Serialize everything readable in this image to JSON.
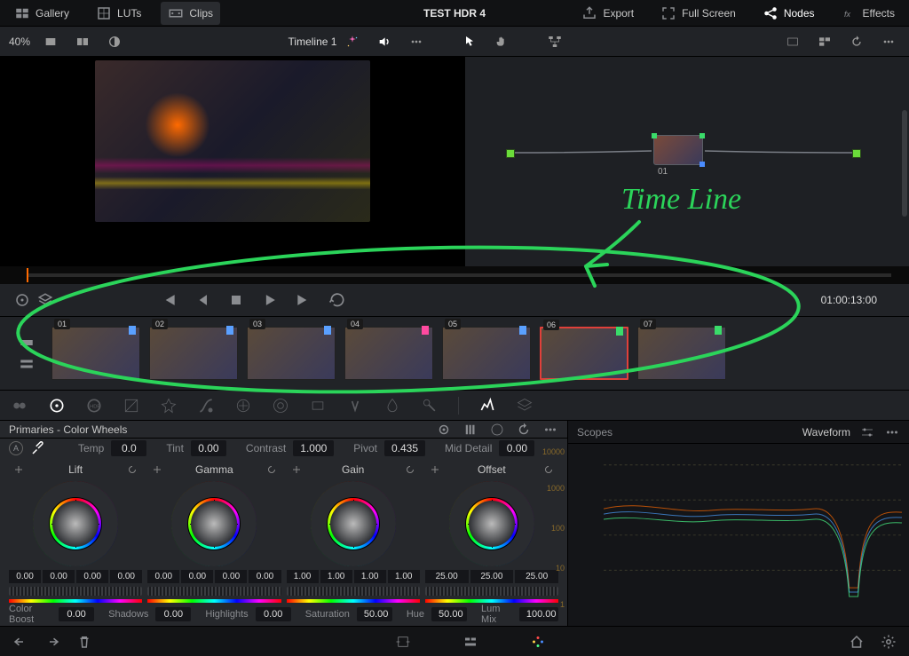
{
  "project_title": "TEST HDR 4",
  "top": {
    "gallery": "Gallery",
    "luts": "LUTs",
    "clips": "Clips",
    "export": "Export",
    "fullscreen": "Full Screen",
    "nodes": "Nodes",
    "effects": "Effects"
  },
  "toolbar": {
    "zoom": "40%",
    "timeline": "Timeline 1"
  },
  "timecode": "01:00:13:00",
  "node": {
    "label": "01"
  },
  "clips": [
    {
      "num": "01",
      "flag": "#5aa0ff"
    },
    {
      "num": "02",
      "flag": "#5aa0ff"
    },
    {
      "num": "03",
      "flag": "#5aa0ff"
    },
    {
      "num": "04",
      "flag": "#ff4aa0"
    },
    {
      "num": "05",
      "flag": "#5aa0ff"
    },
    {
      "num": "06",
      "flag": "#3adc6a"
    },
    {
      "num": "07",
      "flag": "#3adc6a"
    }
  ],
  "primaries": {
    "title": "Primaries - Color Wheels",
    "temp": {
      "label": "Temp",
      "val": "0.0"
    },
    "tint": {
      "label": "Tint",
      "val": "0.00"
    },
    "contrast": {
      "label": "Contrast",
      "val": "1.000"
    },
    "pivot": {
      "label": "Pivot",
      "val": "0.435"
    },
    "middetail": {
      "label": "Mid Detail",
      "val": "0.00"
    },
    "wheels": [
      {
        "name": "Lift",
        "vals": [
          "0.00",
          "0.00",
          "0.00",
          "0.00"
        ]
      },
      {
        "name": "Gamma",
        "vals": [
          "0.00",
          "0.00",
          "0.00",
          "0.00"
        ]
      },
      {
        "name": "Gain",
        "vals": [
          "1.00",
          "1.00",
          "1.00",
          "1.00"
        ]
      },
      {
        "name": "Offset",
        "vals": [
          "25.00",
          "25.00",
          "25.00"
        ]
      }
    ],
    "colorboost": {
      "label": "Color Boost",
      "val": "0.00"
    },
    "shadows": {
      "label": "Shadows",
      "val": "0.00"
    },
    "highlights": {
      "label": "Highlights",
      "val": "0.00"
    },
    "saturation": {
      "label": "Saturation",
      "val": "50.00"
    },
    "hue": {
      "label": "Hue",
      "val": "50.00"
    },
    "lummix": {
      "label": "Lum Mix",
      "val": "100.00"
    }
  },
  "scopes": {
    "title": "Scopes",
    "mode": "Waveform",
    "ticks": [
      "10000",
      "1000",
      "100",
      "10",
      "1"
    ]
  },
  "annotation": "Time Line"
}
